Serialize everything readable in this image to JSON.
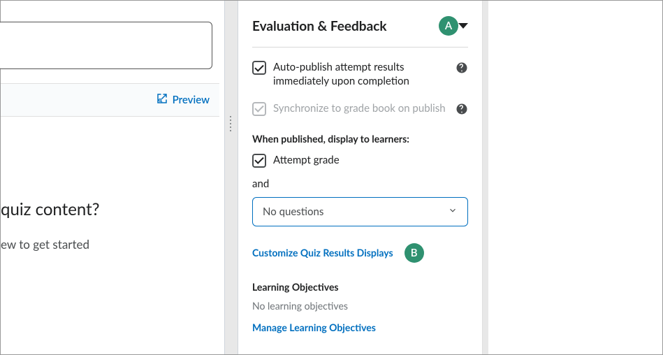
{
  "left": {
    "preview_label": "Preview",
    "heading": "quiz content?",
    "sub": "ew to get started"
  },
  "panel": {
    "title": "Evaluation & Feedback",
    "badge_a": "A",
    "auto_publish_label": "Auto-publish attempt results immediately upon completion",
    "sync_label": "Synchronize to grade book on publish",
    "display_heading": "When published, display to learners:",
    "attempt_grade_label": "Attempt grade",
    "and_label": "and",
    "select_value": "No questions",
    "customize_link": "Customize Quiz Results Displays",
    "badge_b": "B",
    "objectives_heading": "Learning Objectives",
    "objectives_empty": "No learning objectives",
    "manage_link": "Manage Learning Objectives"
  }
}
